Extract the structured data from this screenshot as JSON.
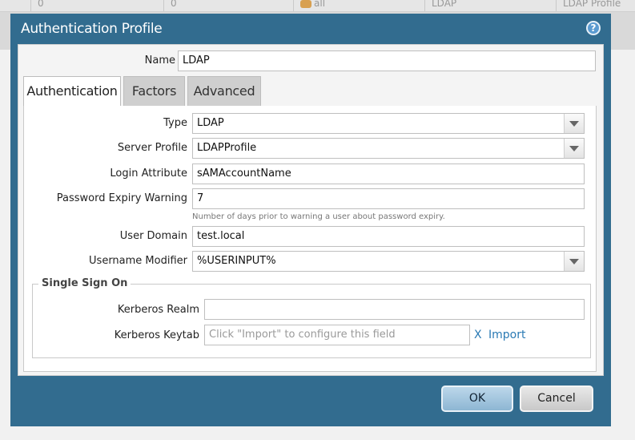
{
  "background": {
    "cells": [
      "0",
      "0",
      "all",
      "LDAP",
      "LDAP Profile"
    ]
  },
  "dialog": {
    "title": "Authentication Profile",
    "help_icon": "help-icon"
  },
  "name_field": {
    "label": "Name",
    "value": "LDAP"
  },
  "tabs": [
    {
      "label": "Authentication",
      "active": true
    },
    {
      "label": "Factors",
      "active": false
    },
    {
      "label": "Advanced",
      "active": false
    }
  ],
  "form": {
    "type": {
      "label": "Type",
      "value": "LDAP"
    },
    "server_profile": {
      "label": "Server Profile",
      "value": "LDAPProfile"
    },
    "login_attribute": {
      "label": "Login Attribute",
      "value": "sAMAccountName"
    },
    "password_expiry": {
      "label": "Password Expiry Warning",
      "value": "7",
      "hint": "Number of days prior to warning a user about password expiry."
    },
    "user_domain": {
      "label": "User Domain",
      "value": "test.local"
    },
    "username_modifier": {
      "label": "Username Modifier",
      "value": "%USERINPUT%"
    }
  },
  "sso": {
    "legend": "Single Sign On",
    "kerberos_realm": {
      "label": "Kerberos Realm",
      "value": ""
    },
    "kerberos_keytab": {
      "label": "Kerberos Keytab",
      "placeholder": "Click \"Import\" to configure this field",
      "clear_label": "X",
      "import_label": "Import"
    }
  },
  "buttons": {
    "ok": "OK",
    "cancel": "Cancel"
  },
  "colors": {
    "titlebar": "#326c8f",
    "link": "#2a7ab4",
    "ok_button": "#a6c8e0"
  }
}
